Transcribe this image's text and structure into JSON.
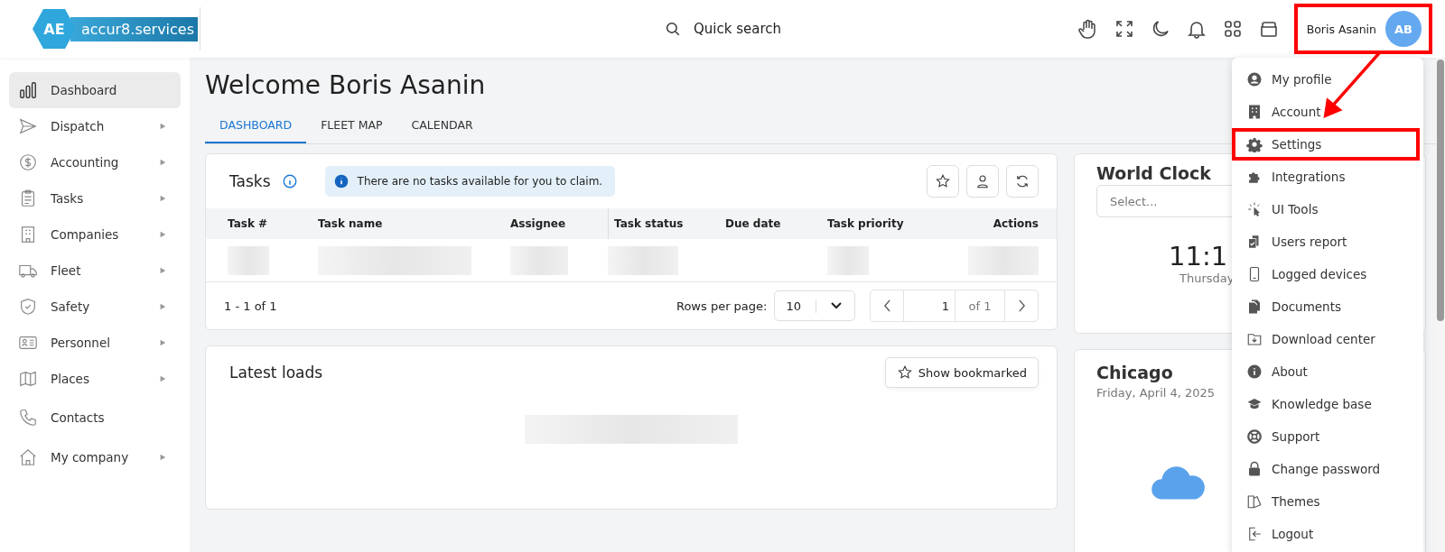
{
  "header": {
    "logo_text": "accur8.services",
    "logo_mark": "AE",
    "search_label": "Quick search",
    "user_name": "Boris Asanin",
    "user_initials": "AB",
    "user_highlighted": true
  },
  "sidebar": {
    "items": [
      {
        "label": "Dashboard",
        "selected": true,
        "has_submenu": false
      },
      {
        "label": "Dispatch",
        "selected": false,
        "has_submenu": true
      },
      {
        "label": "Accounting",
        "selected": false,
        "has_submenu": true
      },
      {
        "label": "Tasks",
        "selected": false,
        "has_submenu": true
      },
      {
        "label": "Companies",
        "selected": false,
        "has_submenu": true
      },
      {
        "label": "Fleet",
        "selected": false,
        "has_submenu": true
      },
      {
        "label": "Safety",
        "selected": false,
        "has_submenu": true
      },
      {
        "label": "Personnel",
        "selected": false,
        "has_submenu": true
      },
      {
        "label": "Places",
        "selected": false,
        "has_submenu": true
      },
      {
        "label": "Contacts",
        "selected": false,
        "has_submenu": false
      },
      {
        "label": "My company",
        "selected": false,
        "has_submenu": true
      }
    ]
  },
  "page": {
    "title": "Welcome Boris Asanin",
    "tabs": [
      {
        "label": "DASHBOARD",
        "selected": true
      },
      {
        "label": "FLEET MAP",
        "selected": false
      },
      {
        "label": "CALENDAR",
        "selected": false
      }
    ]
  },
  "tasks": {
    "title": "Tasks",
    "notice": "There are no tasks available for you to claim.",
    "columns": [
      "Task #",
      "Task name",
      "Assignee",
      "Task status",
      "Due date",
      "Task priority",
      "Actions"
    ],
    "range": "1 - 1 of 1",
    "rows_per_page_label": "Rows per page:",
    "rows_per_page": "10",
    "page": "1",
    "page_of": "of 1"
  },
  "latest_loads": {
    "title": "Latest loads",
    "button": "Show bookmarked"
  },
  "world_clock": {
    "title": "World Clock",
    "placeholder": "Select...",
    "time": "11:1",
    "day": "Thursday"
  },
  "city": {
    "name": "Chicago",
    "date": "Friday, April 4, 2025"
  },
  "user_menu": {
    "items": [
      {
        "label": "My profile",
        "highlighted": false
      },
      {
        "label": "Account",
        "highlighted": false
      },
      {
        "label": "Settings",
        "highlighted": true
      },
      {
        "label": "Integrations",
        "highlighted": false
      },
      {
        "label": "UI Tools",
        "highlighted": false
      },
      {
        "label": "Users report",
        "highlighted": false
      },
      {
        "label": "Logged devices",
        "highlighted": false
      },
      {
        "label": "Documents",
        "highlighted": false
      },
      {
        "label": "Download center",
        "highlighted": false
      },
      {
        "label": "About",
        "highlighted": false
      },
      {
        "label": "Knowledge base",
        "highlighted": false
      },
      {
        "label": "Support",
        "highlighted": false
      },
      {
        "label": "Change password",
        "highlighted": false
      },
      {
        "label": "Themes",
        "highlighted": false
      },
      {
        "label": "Logout",
        "highlighted": false
      }
    ]
  }
}
